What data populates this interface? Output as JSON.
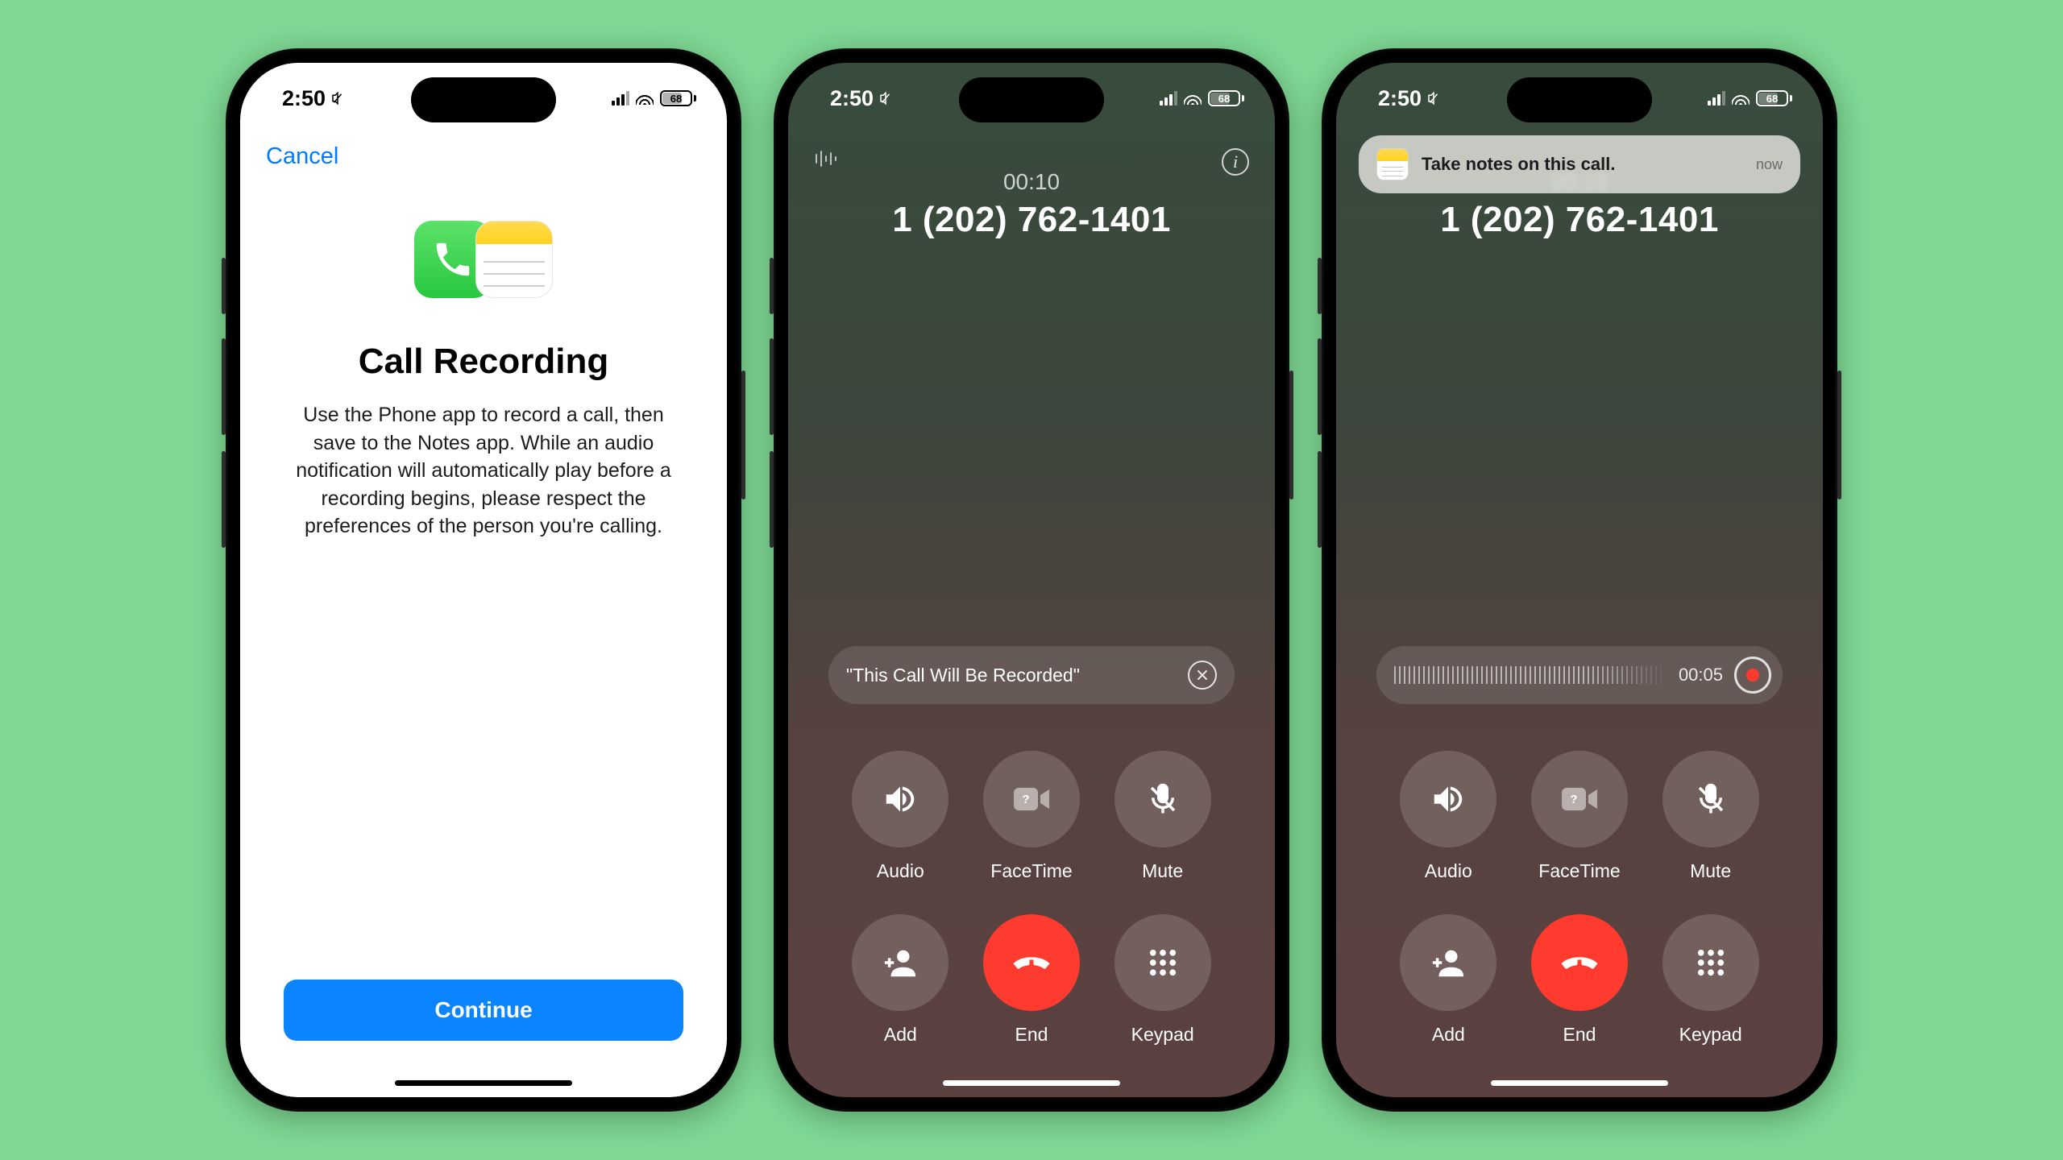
{
  "status": {
    "time": "2:50",
    "battery": "68"
  },
  "screen1": {
    "cancel": "Cancel",
    "title": "Call Recording",
    "desc": "Use the Phone app to record a call, then save to the Notes app. While an audio notification will automatically play before a recording begins, please respect the preferences of the person you're calling.",
    "continue": "Continue"
  },
  "screen2": {
    "timer": "00:10",
    "number": "1 (202) 762-1401",
    "banner": "\"This Call Will Be Recorded\"",
    "buttons": {
      "audio": "Audio",
      "facetime": "FaceTime",
      "mute": "Mute",
      "add": "Add",
      "end": "End",
      "keypad": "Keypad"
    }
  },
  "screen3": {
    "timer": "00:16",
    "number": "1 (202) 762-1401",
    "rec_time": "00:05",
    "notif": {
      "text": "Take notes on this call.",
      "time_label": "now"
    },
    "buttons": {
      "audio": "Audio",
      "facetime": "FaceTime",
      "mute": "Mute",
      "add": "Add",
      "end": "End",
      "keypad": "Keypad"
    }
  }
}
